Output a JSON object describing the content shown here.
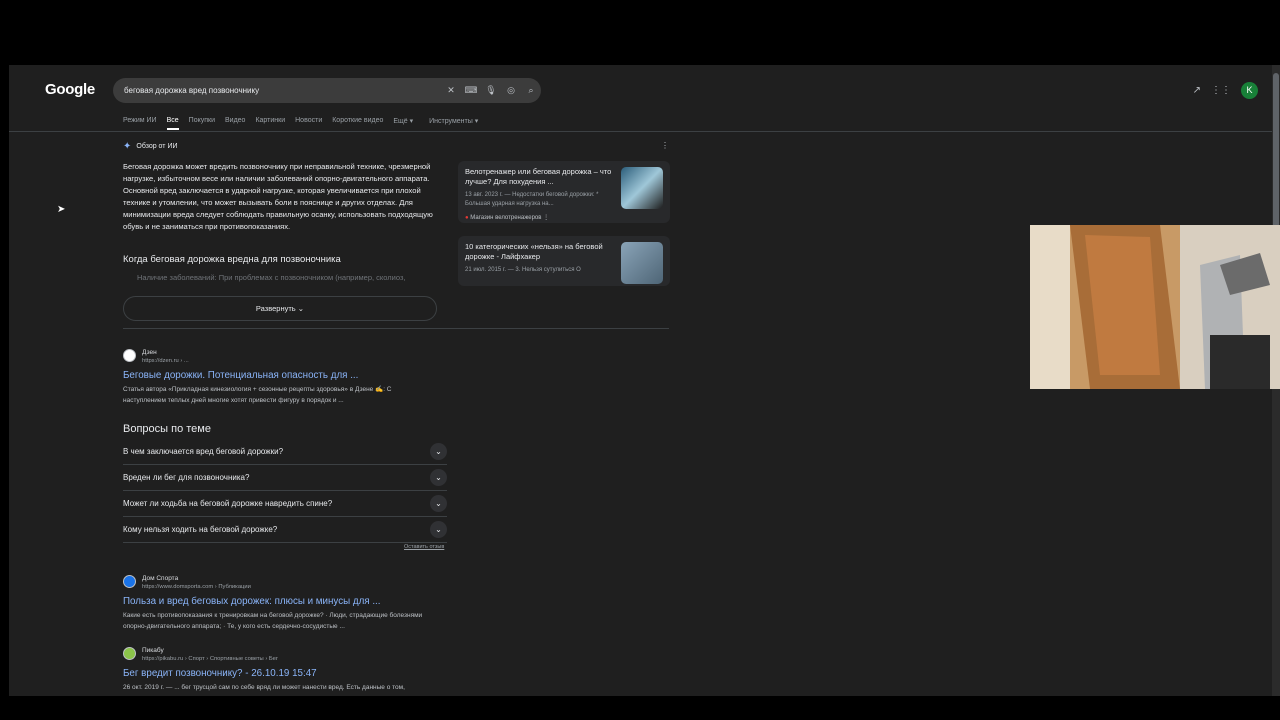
{
  "logo": "Google",
  "search": {
    "query": "беговая дорожка вред позвоночнику"
  },
  "tabs": [
    "Режим ИИ",
    "Все",
    "Покупки",
    "Видео",
    "Картинки",
    "Новости",
    "Короткие видео",
    "Ещё ▾",
    "Инструменты ▾"
  ],
  "active_tab": "Все",
  "avatar_letter": "K",
  "ai_overview": {
    "heading": "Обзор от ИИ",
    "text": "Беговая дорожка может вредить позвоночнику при неправильной технике, чрезмерной нагрузке, избыточном весе или наличии заболеваний опорно-двигательного аппарата. Основной вред заключается в ударной нагрузке, которая увеличивается при плохой технике и утомлении, что может вызывать боли в пояснице и других отделах. Для минимизации вреда следует соблюдать правильную осанку, использовать подходящую обувь и не заниматься при противопоказаниях.",
    "subheading": "Когда беговая дорожка вредна для позвоночника",
    "faded_item": "Наличие заболеваний: При проблемах с позвоночником (например, сколиоз,",
    "expand_label": "Развернуть"
  },
  "ai_cards": [
    {
      "title": "Велотренажер или беговая дорожка – что лучше? Для похудения ...",
      "meta": "13 авг. 2023 г. — Недостатки беговой дорожки: * Большая ударная нагрузка на...",
      "source": "Магазин велотренажеров"
    },
    {
      "title": "10 категорических «нельзя» на беговой дорожке - Лайфхакер",
      "meta": "21 июл. 2015 г. — 3. Нельзя сутулиться О"
    }
  ],
  "results": [
    {
      "site": "Дзен",
      "url": "https://dzen.ru › ...",
      "title": "Беговые дорожки. Потенциальная опасность для ...",
      "snippet": "Статья автора «Прикладная кинезиология + сезонные рецепты здоровья» в Дзене ✍: С наступлением теплых дней многие хотят привести фигуру в порядок и ..."
    },
    {
      "site": "Дом Спорта",
      "url": "https://www.domsporta.com › Публикации",
      "title": "Польза и вред беговых дорожек: плюсы и минусы для ...",
      "snippet": "Какие есть противопоказания к тренировкам на беговой дорожке? · Люди, страдающие болезнями опорно-двигательного аппарата; · Те, у кого есть сердечно-сосудистые ..."
    },
    {
      "site": "Пикабу",
      "url": "https://pikabu.ru › Спорт › Спортивные советы › Бег",
      "title": "Бег вредит позвоночнику? - 26.10.19 15:47",
      "snippet": "26 окт. 2019 г. — ... бег трусцой сам по себе вряд ли может нанести вред. Есть данные о том,"
    }
  ],
  "paa": {
    "title": "Вопросы по теме",
    "questions": [
      "В чем заключается вред беговой дорожки?",
      "Вреден ли бег для позвоночника?",
      "Может ли ходьба на беговой дорожке навредить спине?",
      "Кому нельзя ходить на беговой дорожке?"
    ],
    "feedback": "Оставить отзыв"
  }
}
